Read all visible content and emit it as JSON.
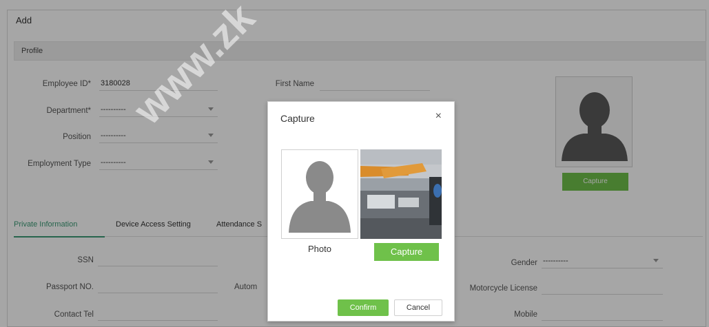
{
  "page": {
    "title": "Add",
    "section": "Profile"
  },
  "profile": {
    "employee_id_label": "Employee ID*",
    "employee_id_value": "3180028",
    "first_name_label": "First Name",
    "department_label": "Department*",
    "department_value": "----------",
    "position_label": "Position",
    "position_value": "----------",
    "employment_type_label": "Employment Type",
    "employment_type_value": "----------",
    "capture_label": "Capture"
  },
  "tabs": [
    {
      "label": "Private Information"
    },
    {
      "label": "Device Access Setting"
    },
    {
      "label": "Attendance S"
    }
  ],
  "private": {
    "ssn_label": "SSN",
    "passport_label": "Passport NO.",
    "autom_label": "Autom",
    "contact_label": "Contact Tel",
    "gender_label": "Gender",
    "gender_value": "----------",
    "motorcycle_label": "Motorcycle License",
    "mobile_label": "Mobile"
  },
  "dialog": {
    "title": "Capture",
    "close": "×",
    "photo_label": "Photo",
    "capture_label": "Capture",
    "confirm_label": "Confirm",
    "cancel_label": "Cancel"
  },
  "watermark": "www.zk",
  "colors": {
    "accent": "#6fc14a",
    "tab_active": "#3b9a75"
  },
  "icons": [
    "close-icon",
    "avatar-silhouette-icon",
    "chevron-down-icon"
  ]
}
